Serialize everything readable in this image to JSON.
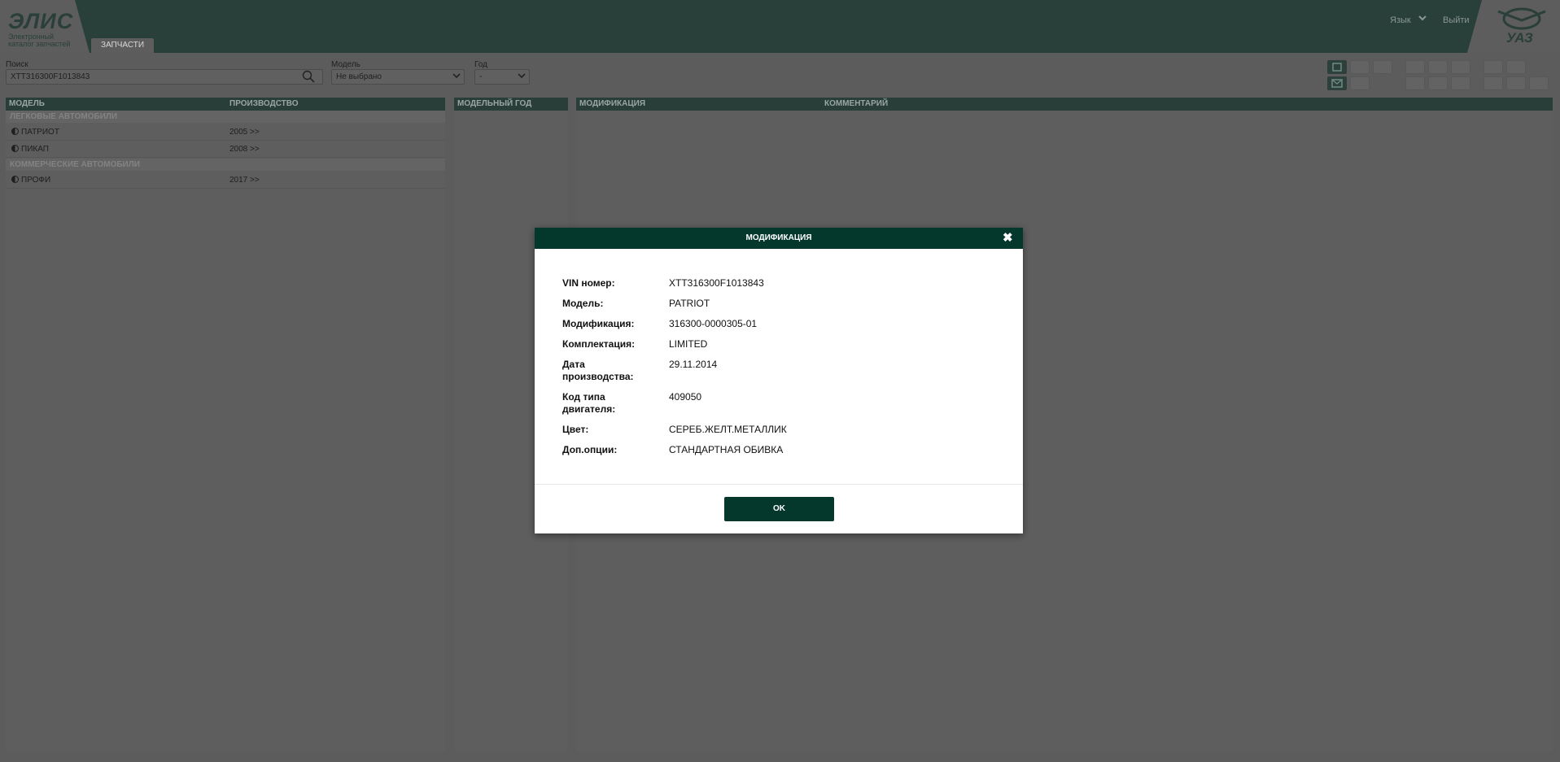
{
  "header": {
    "logo_title": "ЭЛИС",
    "logo_subtitle": "Электронный каталог запчастей",
    "tab_parts": "ЗАПЧАСТИ",
    "lang": "Язык",
    "logout": "Выйти",
    "brand": "УАЗ"
  },
  "toolbar": {
    "search_label": "Поиск",
    "search_value": "XTT316300F1013843",
    "model_label": "Модель",
    "model_value": "Не выбрано",
    "year_label": "Год",
    "year_value": "-"
  },
  "models_panel": {
    "col_model": "МОДЕЛЬ",
    "col_production": "ПРОИЗВОДСТВО",
    "groups": [
      {
        "title": "ЛЕГКОВЫЕ АВТОМОБИЛИ",
        "rows": [
          {
            "name": "ПАТРИОТ",
            "production": "2005 >>"
          },
          {
            "name": "ПИКАП",
            "production": "2008 >>"
          }
        ]
      },
      {
        "title": "КОММЕРЧЕСКИЕ АВТОМОБИЛИ",
        "rows": [
          {
            "name": "ПРОФИ",
            "production": "2017 >>"
          }
        ]
      }
    ]
  },
  "year_panel": {
    "col_year": "МОДЕЛЬНЫЙ ГОД"
  },
  "mod_panel": {
    "col_modification": "МОДИФИКАЦИЯ",
    "col_comment": "КОММЕНТАРИЙ"
  },
  "modal": {
    "title": "МОДИФИКАЦИЯ",
    "close_glyph": "✖",
    "fields": [
      {
        "label": "VIN номер:",
        "value": "XTT316300F1013843"
      },
      {
        "label": "Модель:",
        "value": "PATRIOT"
      },
      {
        "label": "Модификация:",
        "value": "316300-0000305-01"
      },
      {
        "label": "Комплектация:",
        "value": "LIMITED"
      },
      {
        "label": "Дата производства:",
        "value": "29.11.2014"
      },
      {
        "label": "Код типа двигателя:",
        "value": "409050"
      },
      {
        "label": "Цвет:",
        "value": "СЕРЕБ.ЖЕЛТ.МЕТАЛЛИК"
      },
      {
        "label": "Доп.опции:",
        "value": "СТАНДАРТНАЯ ОБИВКА"
      }
    ],
    "ok": "OK"
  },
  "colors": {
    "header_bg": "#293f3a",
    "overlay_bg": "#5b5c5b",
    "modal_accent": "#04382d",
    "button_text": "#ffffff"
  }
}
